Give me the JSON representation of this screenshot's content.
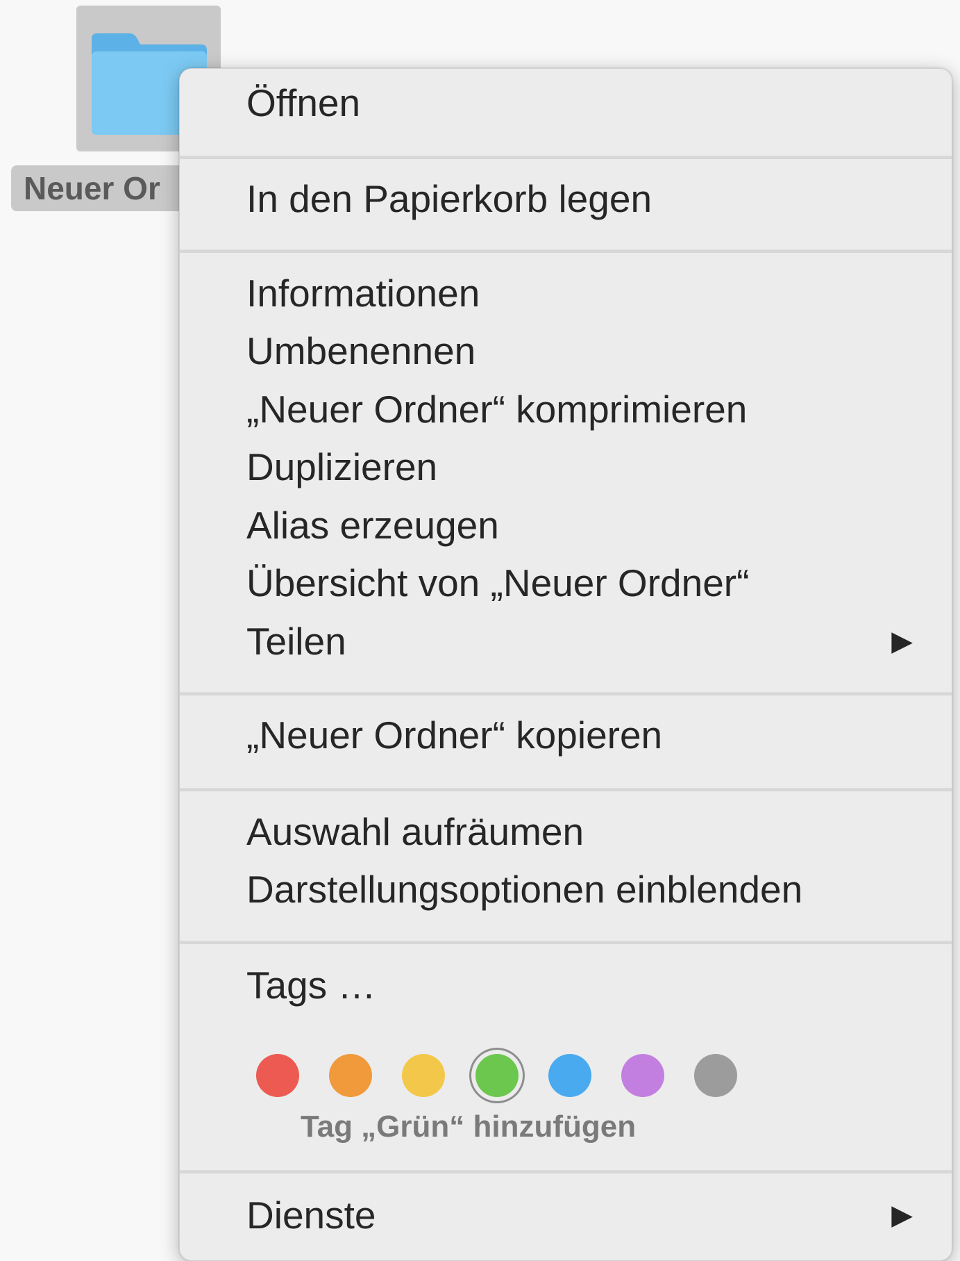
{
  "desktop": {
    "folder_name": "Neuer Or",
    "folder_color": "#6fbfef"
  },
  "menu": {
    "groups": [
      [
        "Öffnen"
      ],
      [
        "In den Papierkorb legen"
      ],
      [
        "Informationen",
        "Umbenennen",
        "„Neuer Ordner“ komprimieren",
        "Duplizieren",
        "Alias erzeugen",
        "Übersicht von „Neuer Ordner“",
        "Teilen"
      ],
      [
        "„Neuer Ordner“ kopieren"
      ],
      [
        "Auswahl aufräumen",
        "Darstellungsoptionen einblenden"
      ],
      [
        "Tags …"
      ],
      [
        "Dienste"
      ]
    ],
    "submenu_arrow": "▶",
    "tags": {
      "hint": "Tag „Grün“ hinzufügen",
      "selected": "green",
      "colors": [
        {
          "name": "red",
          "hex": "#ec5a52"
        },
        {
          "name": "orange",
          "hex": "#f09a3c"
        },
        {
          "name": "yellow",
          "hex": "#f3c84a"
        },
        {
          "name": "green",
          "hex": "#6cc74f"
        },
        {
          "name": "blue",
          "hex": "#4aaaf0"
        },
        {
          "name": "purple",
          "hex": "#c27fe0"
        },
        {
          "name": "gray",
          "hex": "#9c9c9c"
        }
      ]
    }
  }
}
